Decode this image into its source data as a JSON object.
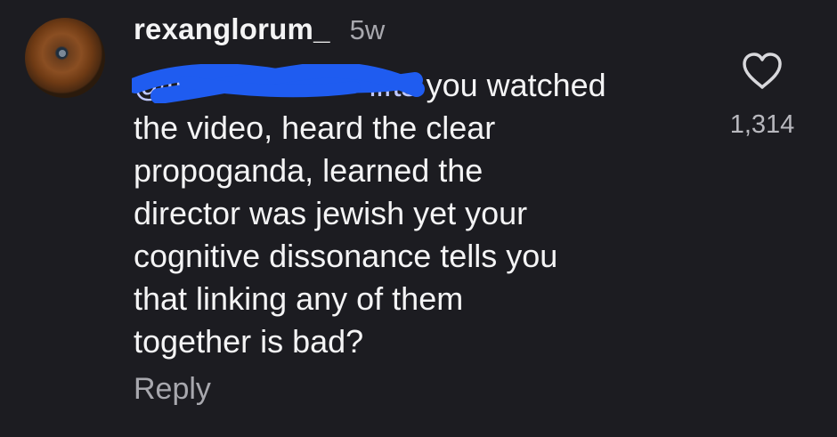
{
  "comment": {
    "username": "rexanglorum_",
    "time": "5w",
    "mention_visible": "@ti",
    "mention_tail_visible": "lifts",
    "lines": [
      "you watched",
      "the video, heard the clear",
      "propoganda, learned the",
      "director was jewish yet your",
      "cognitive dissonance tells you",
      "that linking any of them",
      "together is bad?"
    ],
    "reply_label": "Reply",
    "like_count": "1,314"
  },
  "icons": {
    "like": "heart-outline-icon",
    "avatar": "user-avatar"
  },
  "colors": {
    "background": "#1c1c21",
    "text": "#f4f4f5",
    "secondary_text": "#a8a8ae",
    "redaction": "#1f5cf0"
  }
}
